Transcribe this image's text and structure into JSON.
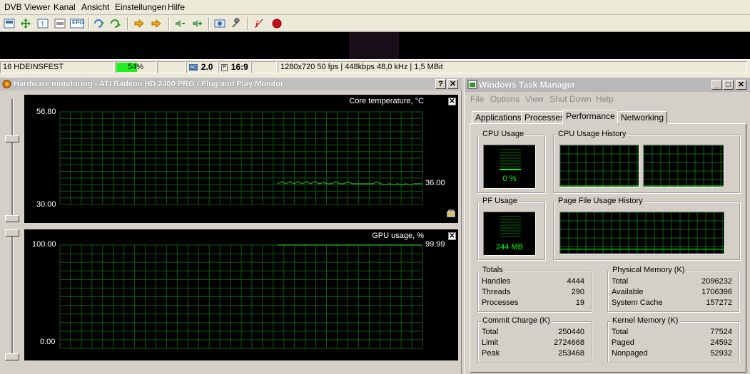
{
  "dvb": {
    "menu": [
      "DVB Viewer",
      "Kanal",
      "Ansicht",
      "Einstellungen",
      "Hilfe"
    ],
    "toolbar_icons": [
      "window-mode-icon",
      "move-icon",
      "teletext-icon",
      "osd-icon",
      "epg-icon",
      "channel-up-icon",
      "channel-down-icon",
      "previous-icon",
      "next-icon",
      "volume-down-icon",
      "volume-up-icon",
      "recordings-icon",
      "settings-icon",
      "info-icon",
      "record-icon"
    ],
    "epg_label": "EPG",
    "status": {
      "channel": "16 HDEINSFEST",
      "signal_text": "54%",
      "signal_level": 0.54,
      "audio_badge": "AC",
      "audio_value": "2.0",
      "aspect_badge": "P",
      "aspect_value": "16:9",
      "info": "1280x720 50 fps | 448kbps 48,0 kHz | 1,5 MBit"
    }
  },
  "hw": {
    "title": "Hardware monitoring - ATI Radeon HD 2400 PRO / Plug and Play Monitor",
    "help_label": "?",
    "close_label": "✕",
    "graph_close": "✕",
    "graphs": [
      {
        "title": "Core temperature, °C",
        "ymax_label": "56.80",
        "ymin_label": "30.00",
        "current_label": "36.00"
      },
      {
        "title": "GPU usage, %",
        "ymax_label": "100.00",
        "ymin_label": "0.00",
        "current_label": "99.99"
      }
    ]
  },
  "chart_data": [
    {
      "type": "line",
      "title": "Core temperature, °C",
      "ylim": [
        30.0,
        56.8
      ],
      "grid": true,
      "color": "#1e9c1e",
      "grid_color": "#0b5e0b",
      "series": [
        {
          "values": [
            36.0,
            36.6,
            36.0,
            36.6,
            36.0,
            36.6,
            36.0,
            36.6,
            36.0,
            36.6,
            36.0,
            36.3,
            36.0,
            36.0,
            36.6,
            36.0,
            36.0,
            36.6,
            36.0,
            36.0,
            36.0,
            36.0,
            36.0,
            36.0,
            36.5,
            36.0,
            35.6,
            36.0,
            35.6,
            36.0,
            35.6,
            36.0,
            35.6,
            36.0,
            36.0,
            36.0
          ]
        }
      ]
    },
    {
      "type": "line",
      "title": "GPU usage, %",
      "ylim": [
        0.0,
        100.0
      ],
      "grid": true,
      "color": "#1e9c1e",
      "grid_color": "#0b5e0b",
      "series": [
        {
          "values": [
            99.99,
            99.99,
            99.99,
            99.99,
            99.99,
            99.99,
            99.99,
            99.99,
            99.99,
            99.99,
            99.99,
            99.99,
            99.99,
            99.99,
            99.99,
            99.99,
            99.99,
            99.99,
            99.99,
            99.99,
            99.99,
            99.99,
            99.99,
            99.99,
            99.99,
            99.99,
            99.99,
            99.99,
            99.99,
            99.99,
            99.99,
            99.99,
            99.99,
            99.99,
            99.99,
            99.99
          ]
        }
      ]
    }
  ],
  "tm": {
    "title": "Windows Task Manager",
    "menu": [
      "File",
      "Options",
      "View",
      "Shut Down",
      "Help"
    ],
    "tabs": [
      "Applications",
      "Processes",
      "Performance",
      "Networking"
    ],
    "active_tab": 2,
    "cpu_usage_title": "CPU Usage",
    "cpu_usage_value": "0 %",
    "cpu_usage_level": 0.0,
    "cpu_history_title": "CPU Usage History",
    "pf_usage_title": "PF Usage",
    "pf_usage_value": "244 MB",
    "pf_history_title": "Page File Usage History",
    "totals": {
      "title": "Totals",
      "rows": [
        {
          "label": "Handles",
          "value": "4444"
        },
        {
          "label": "Threads",
          "value": "290"
        },
        {
          "label": "Processes",
          "value": "19"
        }
      ]
    },
    "physical": {
      "title": "Physical Memory (K)",
      "rows": [
        {
          "label": "Total",
          "value": "2096232"
        },
        {
          "label": "Available",
          "value": "1706396"
        },
        {
          "label": "System Cache",
          "value": "157272"
        }
      ]
    },
    "commit": {
      "title": "Commit Charge (K)",
      "rows": [
        {
          "label": "Total",
          "value": "250440"
        },
        {
          "label": "Limit",
          "value": "2724668"
        },
        {
          "label": "Peak",
          "value": "253468"
        }
      ]
    },
    "kernel": {
      "title": "Kernel Memory (K)",
      "rows": [
        {
          "label": "Total",
          "value": "77524"
        },
        {
          "label": "Paged",
          "value": "24592"
        },
        {
          "label": "Nonpaged",
          "value": "52932"
        }
      ]
    },
    "minimize_label": "_",
    "maximize_label": "□",
    "close_label": "✕"
  }
}
